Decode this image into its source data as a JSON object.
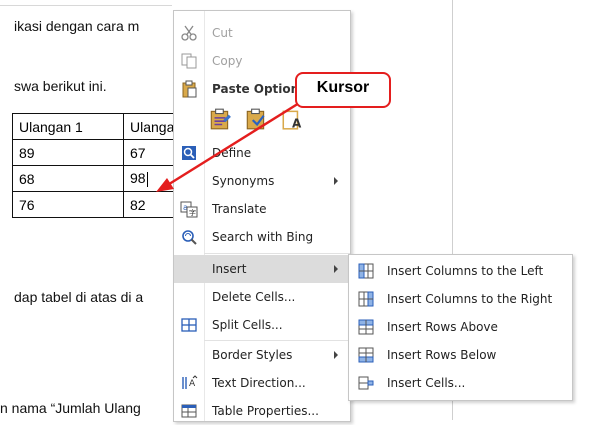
{
  "document": {
    "line1": "ikasi dengan cara m",
    "line2": "swa berikut ini.",
    "line3": "dap tabel di atas di a",
    "line4": "n nama “Jumlah Ulang",
    "table": {
      "headers": [
        "Ulangan 1",
        "Ulanga"
      ],
      "rows": [
        [
          "89",
          "67"
        ],
        [
          "68",
          "98"
        ],
        [
          "76",
          "82"
        ]
      ]
    }
  },
  "context_menu": {
    "items": [
      {
        "label": "Cut",
        "icon": "scissors-icon",
        "state": "disabled"
      },
      {
        "label": "Copy",
        "icon": "copy-icon",
        "state": "disabled"
      },
      {
        "label": "Paste Option",
        "icon": "clipboard-icon",
        "state": "header"
      },
      {
        "label": "Define",
        "icon": "define-icon",
        "state": "normal"
      },
      {
        "label": "Synonyms",
        "icon": "",
        "state": "submenu"
      },
      {
        "label": "Translate",
        "icon": "translate-icon",
        "state": "normal"
      },
      {
        "label": "Search with Bing",
        "icon": "search-icon",
        "state": "normal"
      },
      {
        "label": "Insert",
        "icon": "",
        "state": "highlighted-submenu"
      },
      {
        "label": "Delete Cells...",
        "icon": "",
        "state": "normal"
      },
      {
        "label": "Split Cells...",
        "icon": "split-cells-icon",
        "state": "normal"
      },
      {
        "label": "Border Styles",
        "icon": "",
        "state": "submenu"
      },
      {
        "label": "Text Direction...",
        "icon": "text-direction-icon",
        "state": "normal"
      },
      {
        "label": "Table Properties...",
        "icon": "table-properties-icon",
        "state": "normal"
      }
    ],
    "paste_icons": [
      "paste-keep-formatting-icon",
      "paste-merge-formatting-icon",
      "paste-text-only-icon"
    ]
  },
  "insert_submenu": {
    "items": [
      {
        "label": "Insert Columns to the Left",
        "icon": "insert-columns-left-icon"
      },
      {
        "label": "Insert Columns to the Right",
        "icon": "insert-columns-right-icon"
      },
      {
        "label": "Insert Rows Above",
        "icon": "insert-rows-above-icon"
      },
      {
        "label": "Insert Rows Below",
        "icon": "insert-rows-below-icon"
      },
      {
        "label": "Insert Cells...",
        "icon": "insert-cells-icon"
      }
    ]
  },
  "annotation": {
    "label": "Kursor",
    "color": "#e41e1e"
  }
}
